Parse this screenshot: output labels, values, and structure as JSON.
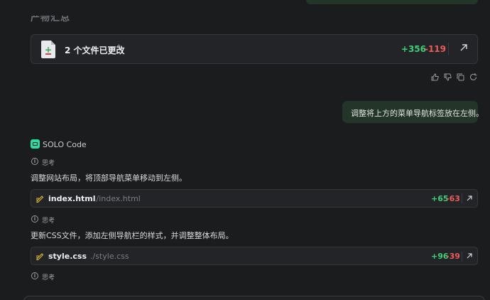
{
  "summary": {
    "heading_cut": "产物汇总",
    "changes_label": "2 个文件已更改",
    "additions": "+356",
    "deletions": "-119"
  },
  "user_message": "调整将上方的菜单导航标签放在左侧。",
  "agent": {
    "name": "SOLO Code",
    "thinking_label": "思考"
  },
  "steps": [
    {
      "text": "调整网站布局，将顶部导航菜单移动到左侧。",
      "file_name": "index.html",
      "file_path": "./index.html",
      "additions": "+65",
      "deletions": "-63"
    },
    {
      "text": "更新CSS文件，添加左侧导航栏的样式，并调整整体布局。",
      "file_name": "style.css",
      "file_path": "./style.css",
      "additions": "+96",
      "deletions": "-39"
    }
  ],
  "icons": {
    "file": "file-diff-icon",
    "chevron": "chevron-up-down-icon",
    "open": "arrow-up-right-icon",
    "like": "thumbs-up-icon",
    "dislike": "thumbs-down-icon",
    "copy": "copy-icon",
    "retry": "refresh-icon",
    "edit": "pencil-edit-icon",
    "info": "info-icon",
    "logo": "solo-code-logo-icon"
  },
  "colors": {
    "background": "#1b1c1e",
    "card": "#222427",
    "user_bubble": "#233528",
    "addition": "#3ecf76",
    "deletion": "#ef5a5a",
    "accent": "#2ed8a0",
    "edit_icon": "#e2b93b"
  }
}
